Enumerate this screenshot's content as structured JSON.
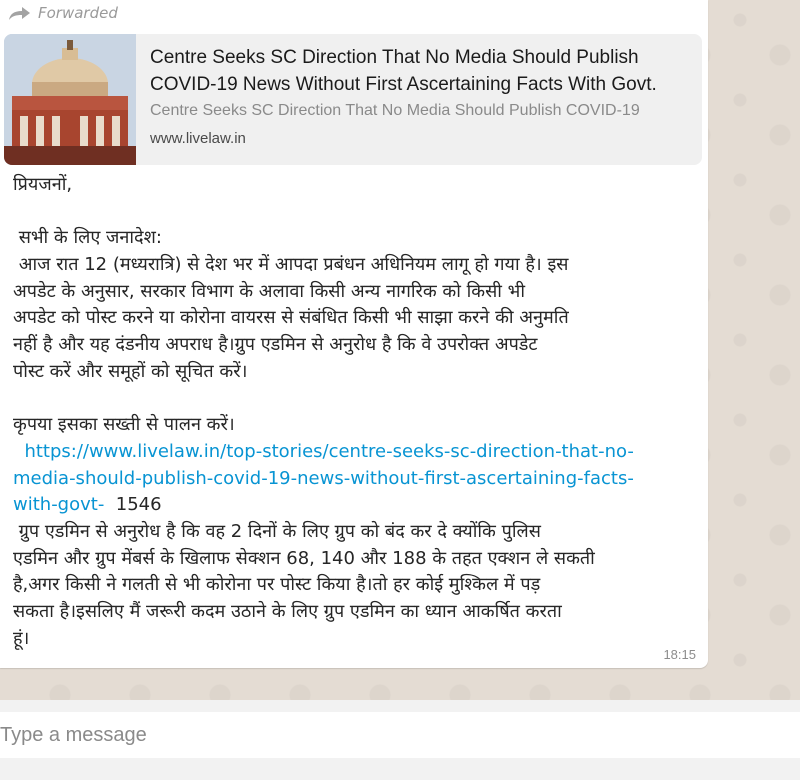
{
  "message": {
    "forwarded_label": "Forwarded",
    "preview": {
      "title": "Centre Seeks SC Direction That No Media Should Publish\nCOVID-19 News Without First Ascertaining Facts With Govt.",
      "description": "Centre Seeks SC Direction That No Media Should Publish COVID-19",
      "domain": "www.livelaw.in",
      "thumbnail_icon": "supreme-court-building"
    },
    "lines": [
      "प्रियजनों,",
      "",
      " सभी के लिए जनादेश:",
      " आज रात 12 (मध्यरात्रि) से देश भर में आपदा प्रबंधन अधिनियम लागू हो गया है। इस",
      "अपडेट के अनुसार, सरकार विभाग के अलावा किसी अन्य नागरिक को किसी भी",
      "अपडेट को पोस्ट करने या कोरोना वायरस से संबंधित किसी भी साझा करने की अनुमति",
      "नहीं है और यह दंडनीय अपराध है।ग्रुप एडमिन से अनुरोध है कि वे उपरोक्त अपडेट",
      "पोस्ट करें और समूहों को सूचित करें।",
      "",
      "कृपया इसका सख्ती से पालन करें।",
      "  https://www.livelaw.in/top-stories/centre-seeks-sc-direction-that-no-",
      "media-should-publish-covid-19-news-without-first-ascertaining-facts-",
      "with-govt-",
      "  1546",
      " ग्रुप एडमिन से अनुरोध है कि वह 2 दिनों के लिए ग्रुप को बंद कर दे क्योंकि पुलिस",
      "एडमिन और ग्रुप मेंबर्स के खिलाफ सेक्शन 68, 140 और 188 के तहत एक्शन ले सकती",
      "है,अगर किसी ने गलती से भी कोरोना पर पोस्ट किया है।तो हर कोई मुश्किल में पड़",
      "सकता है।इसलिए मैं जरूरी कदम उठाने के लिए ग्रुप एडमिन का ध्यान आकर्षित करता",
      "हूं।"
    ],
    "timestamp": "18:15"
  },
  "composer": {
    "placeholder": "Type a message"
  },
  "colors": {
    "link": "#0894d3",
    "bubble": "#ffffff",
    "chat_background": "#e4dcd3"
  }
}
